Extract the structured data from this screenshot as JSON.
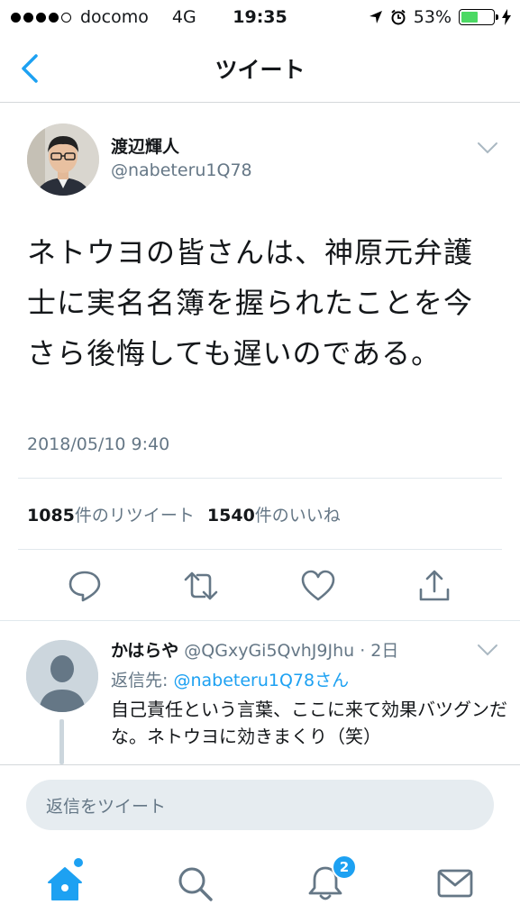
{
  "status_bar": {
    "carrier": "docomo",
    "network": "4G",
    "time": "19:35",
    "battery": "53%",
    "battery_level": 0.53,
    "signal_bars": 4
  },
  "nav": {
    "title": "ツイート",
    "back_icon": "chevron-left-icon"
  },
  "tweet": {
    "author_name": "渡辺輝人",
    "author_handle": "@nabeteru1Q78",
    "text": "ネトウヨの皆さんは、神原元弁護士に実名名簿を握られたことを今さら後悔しても遅いのである。",
    "timestamp": "2018/05/10 9:40",
    "retweet_count": "1085",
    "retweet_label": "件のリツイート",
    "like_count": "1540",
    "like_label": "件のいいね",
    "actions": [
      "reply-icon",
      "retweet-icon",
      "like-icon",
      "share-icon"
    ]
  },
  "reply": {
    "name": "かはらや",
    "handle_time": "@QGxyGi5QvhJ9Jhu · 2日",
    "reply_to_label": "返信先:",
    "reply_to_link": "@nabeteru1Q78さん",
    "text": "自己責任という言葉、ここに来て効果バツグンだな。ネトウヨに効きまくり（笑）"
  },
  "compose": {
    "placeholder": "返信をツイート"
  },
  "tabbar": {
    "notification_count": "2",
    "tabs": [
      "home-icon",
      "search-icon",
      "notifications-icon",
      "messages-icon"
    ]
  },
  "colors": {
    "accent": "#1da1f2",
    "text_primary": "#14171a",
    "text_secondary": "#657786",
    "divider": "#e1e8ed",
    "battery": "#4cd964"
  }
}
